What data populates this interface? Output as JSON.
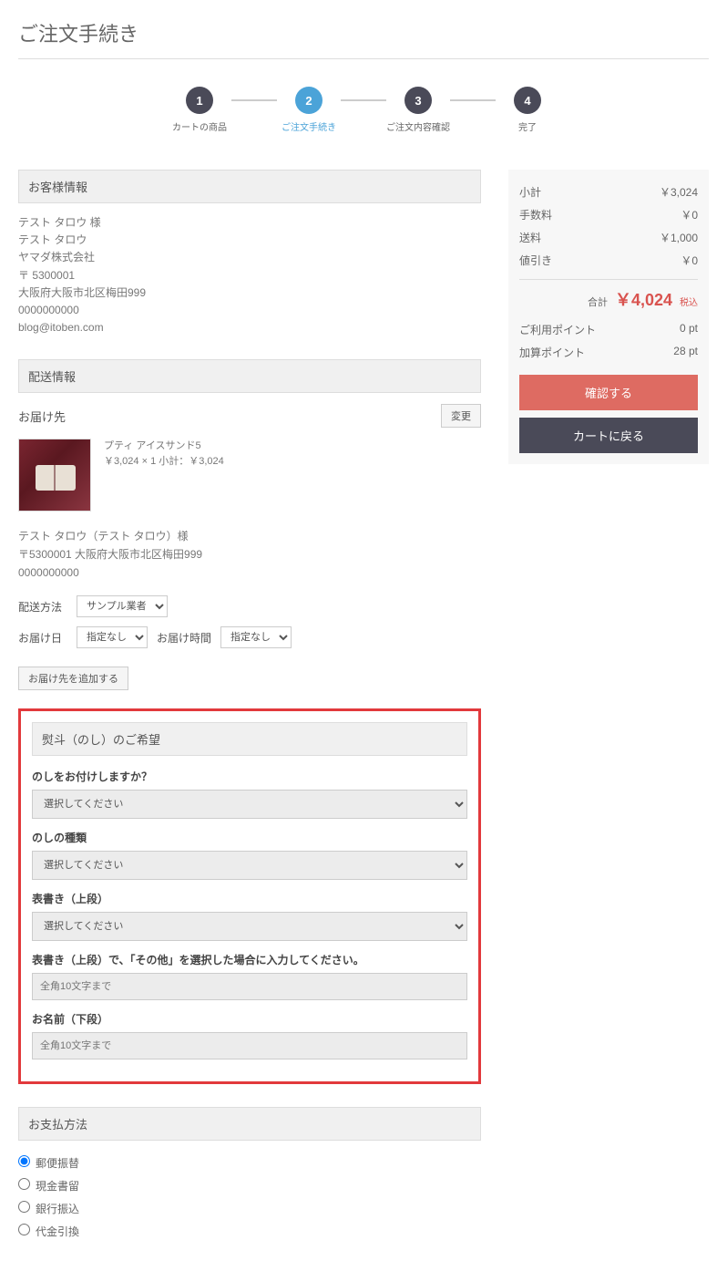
{
  "page_title": "ご注文手続き",
  "steps": [
    {
      "num": "1",
      "label": "カートの商品"
    },
    {
      "num": "2",
      "label": "ご注文手続き"
    },
    {
      "num": "3",
      "label": "ご注文内容確認"
    },
    {
      "num": "4",
      "label": "完了"
    }
  ],
  "customer_section_title": "お客様情報",
  "customer": {
    "name_honorific": "テスト タロウ 様",
    "name_kana": "テスト タロウ",
    "company": "ヤマダ株式会社",
    "postal": "〒 5300001",
    "address": "大阪府大阪市北区梅田999",
    "phone": "0000000000",
    "email": "blog@itoben.com"
  },
  "delivery_section_title": "配送情報",
  "delivery_to_label": "お届け先",
  "change_btn": "変更",
  "product": {
    "name": "プティ  アイスサンド5",
    "line": "￥3,024 × 1  小計：￥3,024"
  },
  "recipient": {
    "name": "テスト タロウ（テスト タロウ）様",
    "addr": "〒5300001 大阪府大阪市北区梅田999",
    "phone": "0000000000"
  },
  "shipping_method_label": "配送方法",
  "shipping_method_value": "サンプル業者",
  "delivery_date_label": "お届け日",
  "delivery_date_value": "指定なし",
  "delivery_time_label": "お届け時間",
  "delivery_time_value": "指定なし",
  "add_address_btn": "お届け先を追加する",
  "noshi": {
    "title": "熨斗（のし）のご希望",
    "attach_label": "のしをお付けしますか？",
    "attach_value": "選択してください",
    "type_label": "のしの種類",
    "type_value": "選択してください",
    "top_label": "表書き（上段）",
    "top_value": "選択してください",
    "other_label": "表書き（上段）で、「その他」を選択した場合に入力してください。",
    "other_placeholder": "全角10文字まで",
    "name_label": "お名前（下段）",
    "name_placeholder": "全角10文字まで"
  },
  "payment": {
    "title": "お支払方法",
    "options": [
      "郵便振替",
      "現金書留",
      "銀行振込",
      "代金引換"
    ]
  },
  "summary": {
    "subtotal_label": "小計",
    "subtotal_value": "￥3,024",
    "fee_label": "手数料",
    "fee_value": "￥0",
    "shipping_label": "送料",
    "shipping_value": "￥1,000",
    "discount_label": "値引き",
    "discount_value": "￥0",
    "total_label": "合計",
    "total_value": "￥4,024",
    "tax_label": "税込",
    "use_points_label": "ご利用ポイント",
    "use_points_value": "0 pt",
    "add_points_label": "加算ポイント",
    "add_points_value": "28 pt",
    "confirm_btn": "確認する",
    "back_btn": "カートに戻る"
  }
}
